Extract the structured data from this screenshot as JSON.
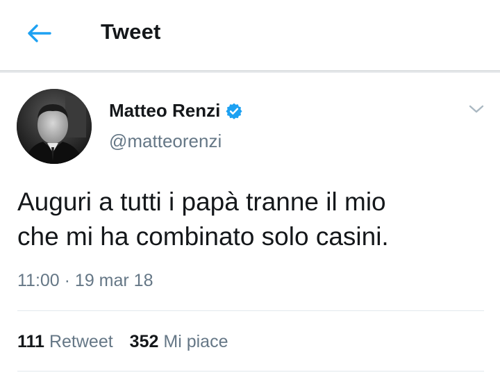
{
  "header": {
    "title": "Tweet",
    "back_icon": "arrow-left-icon",
    "accent_color": "#1da1f2"
  },
  "tweet": {
    "author": {
      "name": "Matteo Renzi",
      "handle": "@matteorenzi",
      "verified": true,
      "verified_icon": "verified-badge-icon"
    },
    "menu_icon": "chevron-down-icon",
    "text_lines": [
      "Auguri a tutti i papà tranne il mio",
      "che mi ha combinato solo casini."
    ],
    "timestamp": "11:00 · 19 mar 18",
    "stats": {
      "retweets_count": "111",
      "retweets_label": "Retweet",
      "likes_count": "352",
      "likes_label": "Mi piace"
    }
  }
}
